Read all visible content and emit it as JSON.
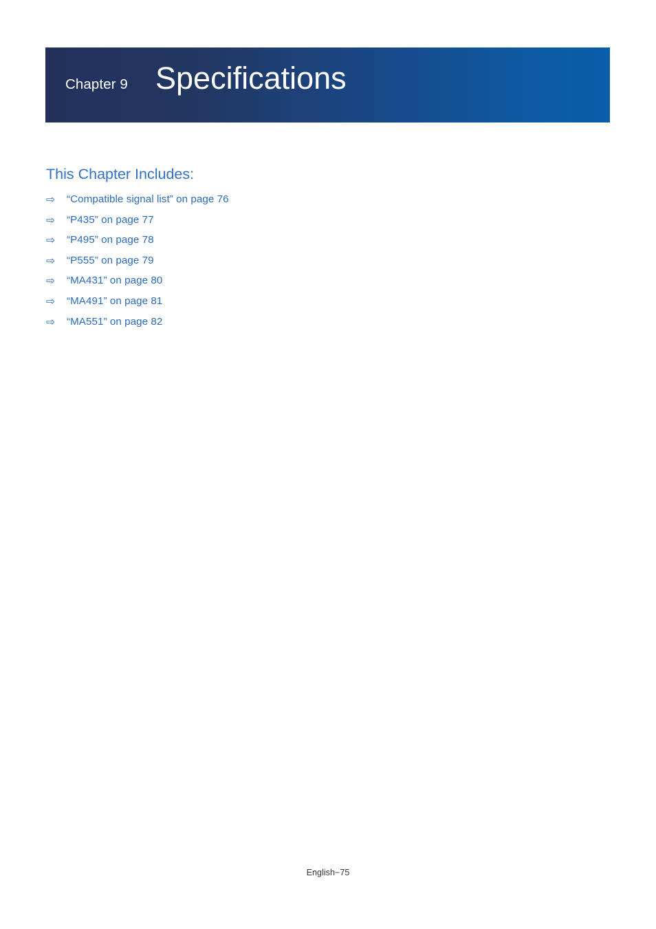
{
  "banner": {
    "chapter_label": "Chapter 9",
    "chapter_title": "Specifications",
    "gradient_start": "#23305c",
    "gradient_end": "#0a5da9",
    "text_color": "#ffffff"
  },
  "section": {
    "heading": "This Chapter Includes:",
    "heading_color": "#2f73c4"
  },
  "toc": {
    "arrow_icon": "⇨",
    "link_color": "#2a6cc0",
    "items": [
      {
        "arrow": "⇨",
        "label": "“Compatible signal list” on page 76"
      },
      {
        "arrow": "⇨",
        "label": "“P435” on page 77"
      },
      {
        "arrow": "⇨",
        "label": "“P495” on page 78"
      },
      {
        "arrow": "⇨",
        "label": "“P555” on page 79"
      },
      {
        "arrow": "⇨",
        "label": "“MA431” on page 80"
      },
      {
        "arrow": "⇨",
        "label": "“MA491” on page 81"
      },
      {
        "arrow": "⇨",
        "label": "“MA551” on page 82"
      }
    ]
  },
  "footer": {
    "page_marker": "English−75"
  }
}
